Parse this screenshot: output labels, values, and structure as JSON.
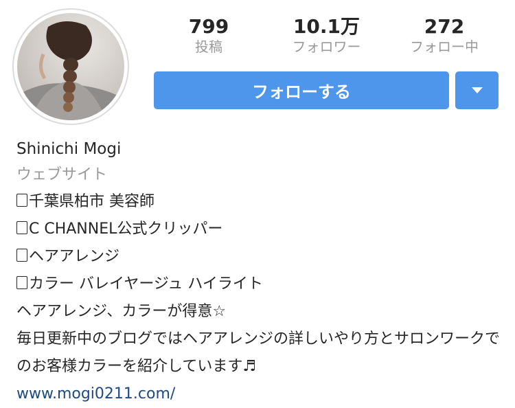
{
  "profile": {
    "name": "Shinichi Mogi",
    "website_label": "ウェブサイト",
    "bio_lines": [
      "千葉県柏市 美容師",
      "C CHANNEL公式クリッパー",
      "ヘアアレンジ",
      "カラー バレイヤージュ ハイライト",
      "ヘアアレンジ、カラーが得意☆",
      "毎日更新中のブログではヘアアレンジの詳しいやり方とサロンワークでのお客様カラーを紹介しています♬"
    ],
    "link": "www.mogi0211.com/"
  },
  "stats": [
    {
      "value": "799",
      "label": "投稿"
    },
    {
      "value": "10.1万",
      "label": "フォロワー"
    },
    {
      "value": "272",
      "label": "フォロー中"
    }
  ],
  "actions": {
    "follow_label": "フォローする"
  },
  "colors": {
    "accent": "#4e95ec",
    "muted_text": "#999999",
    "link": "#1e4a7f",
    "text": "#262626"
  },
  "icons": {
    "dropdown": "triangle-down-icon",
    "bullet": "square-box"
  }
}
